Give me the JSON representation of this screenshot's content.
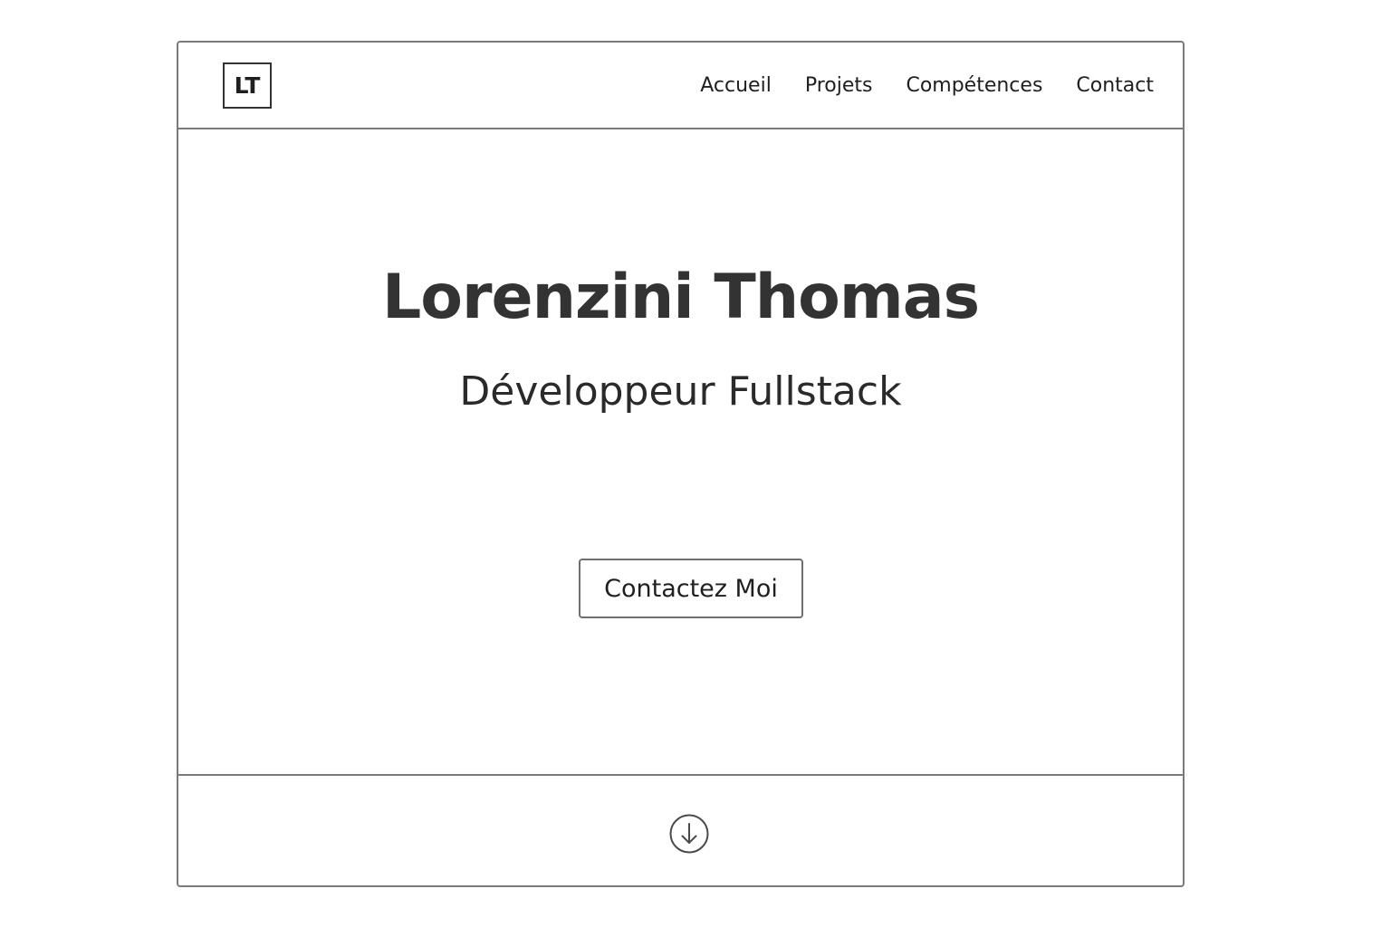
{
  "header": {
    "logo_text": "LT",
    "nav": [
      {
        "label": "Accueil"
      },
      {
        "label": "Projets"
      },
      {
        "label": "Compétences"
      },
      {
        "label": "Contact"
      }
    ]
  },
  "hero": {
    "title": "Lorenzini Thomas",
    "subtitle": "Développeur Fullstack",
    "cta_label": "Contactez Moi"
  },
  "footer": {
    "scroll_icon": "arrow-down-circle-icon"
  }
}
